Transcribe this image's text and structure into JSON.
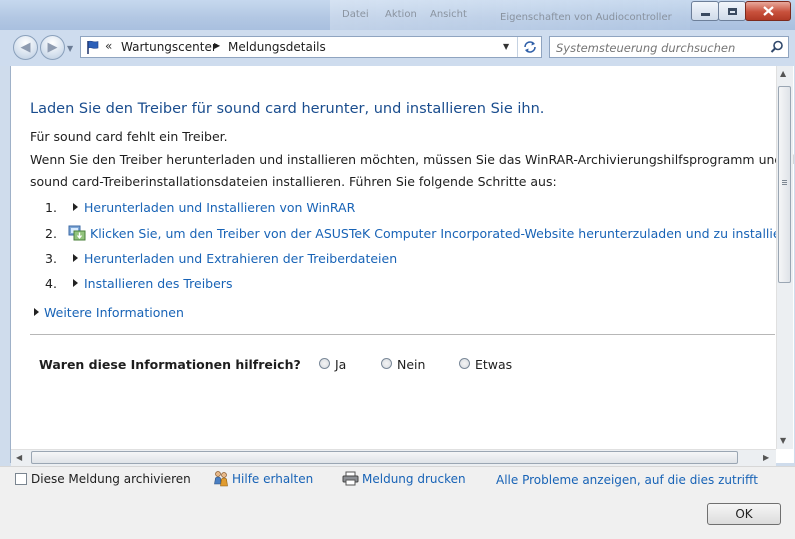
{
  "window": {
    "background_titles": [
      "Datei",
      "Aktion",
      "Ansicht",
      "Eigenschaften von Audiocontroller"
    ],
    "controls": [
      "minimize",
      "maximize",
      "close"
    ]
  },
  "breadcrumb": {
    "items": [
      "Wartungscenter",
      "Meldungsdetails"
    ],
    "separator": "«"
  },
  "search": {
    "placeholder": "Systemsteuerung durchsuchen"
  },
  "content": {
    "heading": "Laden Sie den Treiber für sound card herunter, und installieren Sie ihn.",
    "line1": "Für sound card fehlt ein Treiber.",
    "line2": "Wenn Sie den Treiber herunterladen und installieren möchten, müssen Sie das WinRAR-Archivierungshilfsprogramm und d",
    "line3": "sound card-Treiberinstallationsdateien installieren. Führen Sie folgende Schritte aus:",
    "steps": [
      {
        "num": "1.",
        "label": "Herunterladen und Installieren von WinRAR"
      },
      {
        "num": "2.",
        "label": "Klicken Sie, um den Treiber von der ASUSTeK Computer Incorporated-Website herunterzuladen und zu installiere"
      },
      {
        "num": "3.",
        "label": "Herunterladen und Extrahieren der Treiberdateien"
      },
      {
        "num": "4.",
        "label": "Installieren des Treibers"
      }
    ],
    "more_info": "Weitere Informationen",
    "feedback_question": "Waren diese Informationen hilfreich?",
    "feedback_options": [
      "Ja",
      "Nein",
      "Etwas"
    ]
  },
  "footer": {
    "archive_label": "Diese Meldung archivieren",
    "help_label": "Hilfe erhalten",
    "print_label": "Meldung drucken",
    "all_problems_label": "Alle Probleme anzeigen, auf die dies zutrifft",
    "ok_label": "OK"
  },
  "colors": {
    "link": "#1863b6",
    "heading": "#1a4d8e",
    "titlebar": "#b2c7e3"
  }
}
